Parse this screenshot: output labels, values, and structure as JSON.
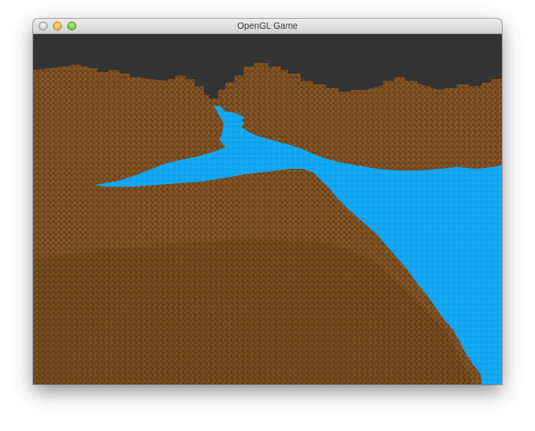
{
  "window": {
    "title": "OpenGL Game"
  },
  "icons": {
    "close": "close-icon",
    "minimize": "minimize-icon",
    "zoom": "zoom-icon"
  },
  "colors": {
    "sky": "#333333",
    "dirt": "#7a4e22",
    "dirt_dark": "#6b4318",
    "dirt_light": "#8a5a2c",
    "water": "#13a6f0",
    "water_dark": "#0b8fd6"
  }
}
